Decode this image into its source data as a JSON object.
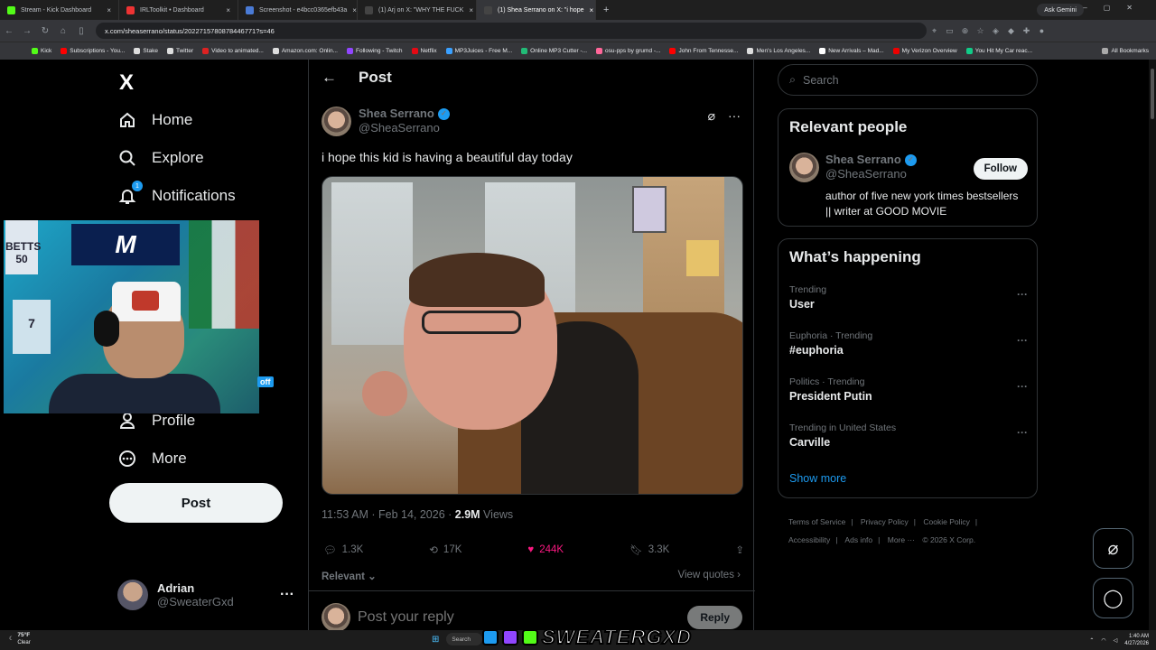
{
  "browser": {
    "tabs": [
      {
        "label": "Stream - Kick Dashboard",
        "color": "#53fc18"
      },
      {
        "label": "IRLToolkit • Dashboard",
        "color": "#e33"
      },
      {
        "label": "Screenshot - e4bcc0365efb43a",
        "color": "#4a7bd6"
      },
      {
        "label": "(1) Arj on X: \"WHY THE FUCK",
        "color": "#444"
      },
      {
        "label": "(1) Shea Serrano on X: \"i hope",
        "color": "#444"
      }
    ],
    "new_tab": "+",
    "ask_gemini": "Ask Gemini",
    "url": "x.com/sheaserrano/status/2022715780878446771?s=46",
    "bookmarks": [
      {
        "label": "Kick",
        "color": "#53fc18"
      },
      {
        "label": "Subscriptions - You...",
        "color": "#f00"
      },
      {
        "label": "Stake",
        "color": "#ddd"
      },
      {
        "label": "Twitter",
        "color": "#ddd"
      },
      {
        "label": "Video to animated...",
        "color": "#d22"
      },
      {
        "label": "Amazon.com: Onlin...",
        "color": "#ddd"
      },
      {
        "label": "Following - Twitch",
        "color": "#9146ff"
      },
      {
        "label": "Netflix",
        "color": "#e50914"
      },
      {
        "label": "MP3Juices - Free M...",
        "color": "#3aa0ff"
      },
      {
        "label": "Online MP3 Cutter -...",
        "color": "#2b7"
      },
      {
        "label": "osu-pps by grumd -...",
        "color": "#f69"
      },
      {
        "label": "John From Tennesse...",
        "color": "#f00"
      },
      {
        "label": "Men's Los Angeles...",
        "color": "#ddd"
      },
      {
        "label": "New Arrivals – Mad...",
        "color": "#fff"
      },
      {
        "label": "My Verizon Overview",
        "color": "#e00"
      },
      {
        "label": "You Hit My Car reac...",
        "color": "#1c8"
      }
    ],
    "all_bookmarks": "All Bookmarks"
  },
  "sidebar": {
    "logo": "X",
    "items": [
      {
        "label": "Home",
        "icon": "home-icon"
      },
      {
        "label": "Explore",
        "icon": "search-icon"
      },
      {
        "label": "Notifications",
        "icon": "bell-icon",
        "badge": "1"
      },
      {
        "label": "Profile",
        "icon": "person-icon"
      },
      {
        "label": "More",
        "icon": "more-circle-icon"
      }
    ],
    "post_button": "Post",
    "account": {
      "name": "Adrian",
      "handle": "@SweaterGxd"
    }
  },
  "webcam": {
    "banner": "M",
    "jersey1": "BETTS 50",
    "jersey2": "7",
    "overlay_tag": "off"
  },
  "post": {
    "header": "Post",
    "author_name": "Shea Serrano",
    "author_handle": "@SheaSerrano",
    "text": "i hope this kid is having a beautiful day today",
    "timestamp": "11:53 AM · Feb 14, 2026 · ",
    "views_count": "2.9M",
    "views_label": " Views",
    "stats": {
      "replies": "1.3K",
      "reposts": "17K",
      "likes": "244K",
      "bookmarks": "3.3K"
    },
    "sort_label": "Relevant",
    "view_quotes": "View quotes",
    "reply_placeholder": "Post your reply",
    "reply_button": "Reply"
  },
  "right": {
    "search_placeholder": "Search",
    "relevant_people_title": "Relevant people",
    "person": {
      "name": "Shea Serrano",
      "handle": "@SheaSerrano",
      "bio": "author of five new york times bestsellers || writer at GOOD MOVIE",
      "follow": "Follow"
    },
    "happening_title": "What’s happening",
    "trends": [
      {
        "context": "Trending",
        "name": "User"
      },
      {
        "context": "Euphoria · Trending",
        "name": "#euphoria"
      },
      {
        "context": "Politics · Trending",
        "name": "President Putin"
      },
      {
        "context": "Trending in United States",
        "name": "Carville"
      }
    ],
    "show_more": "Show more",
    "footer": [
      "Terms of Service",
      "|",
      "Privacy Policy",
      "|",
      "Cookie Policy",
      "|",
      "Accessibility",
      "|",
      "Ads info",
      "|",
      "More ···",
      "© 2026 X Corp."
    ]
  },
  "taskbar": {
    "temp": "75°F",
    "condition": "Clear",
    "search": "Search",
    "brand": "SWEATERGXD",
    "time": "1:40 AM",
    "date": "4/27/2026"
  },
  "colors": {
    "accent": "#1d9bf0",
    "like": "#f91880",
    "kick": "#53fc18",
    "twitch": "#9146ff"
  }
}
